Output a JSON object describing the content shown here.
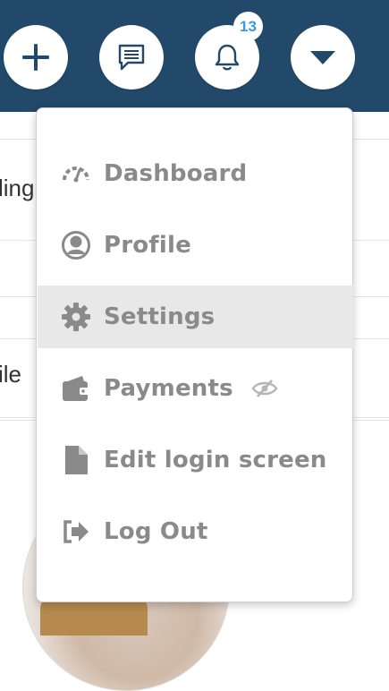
{
  "topbar": {
    "add_icon": "plus-icon",
    "messages_icon": "chat-icon",
    "notifications_icon": "bell-icon",
    "notification_count": "13",
    "account_menu_icon": "caret-down-icon"
  },
  "background": {
    "row1_text": "ling",
    "row2_text": "ile"
  },
  "menu": {
    "items": [
      {
        "label": "Dashboard",
        "icon": "gauge-icon"
      },
      {
        "label": "Profile",
        "icon": "user-circle-icon"
      },
      {
        "label": "Settings",
        "icon": "gear-icon",
        "active": true
      },
      {
        "label": "Payments",
        "icon": "wallet-icon",
        "extra_icon": "eye-slash-icon"
      },
      {
        "label": "Edit login screen",
        "icon": "file-icon"
      },
      {
        "label": "Log Out",
        "icon": "sign-out-icon"
      }
    ]
  },
  "colors": {
    "topbar": "#22496a",
    "menu_text": "#8a8a8a",
    "badge_text": "#3a9bd8",
    "active_bg": "#e8e8e8"
  }
}
